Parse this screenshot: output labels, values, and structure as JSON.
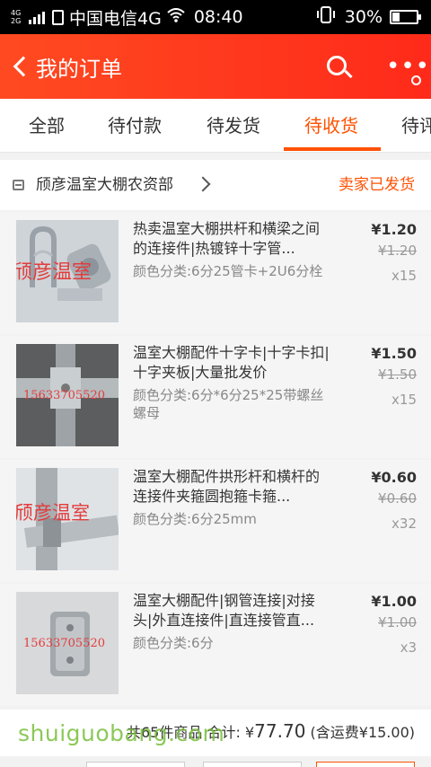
{
  "status_bar": {
    "network_top": "4G",
    "network_bottom": "2G",
    "carrier": "中国电信4G",
    "time": "08:40",
    "battery": "30%",
    "battery_level": 0.3
  },
  "header": {
    "title": "我的订单"
  },
  "tabs": [
    {
      "label": "全部"
    },
    {
      "label": "待付款"
    },
    {
      "label": "待发货"
    },
    {
      "label": "待收货",
      "active": true
    },
    {
      "label": "待评"
    }
  ],
  "shop": {
    "name": "颀彦温室大棚农资部",
    "status": "卖家已发货"
  },
  "items": [
    {
      "title": "热卖温室大棚拱杆和横梁之间的连接件|热镀锌十字管...",
      "sku": "颜色分类:6分25管卡+2U6分栓",
      "price": "¥1.20",
      "original_price": "¥1.20",
      "quantity": "x15",
      "watermark": "颀彦温室"
    },
    {
      "title": "温室大棚配件十字卡|十字卡扣|十字夹板|大量批发价",
      "sku": "颜色分类:6分*6分25*25带螺丝螺母",
      "price": "¥1.50",
      "original_price": "¥1.50",
      "quantity": "x15",
      "watermark": "15633705520"
    },
    {
      "title": "温室大棚配件拱形杆和横杆的连接件夹箍圆抱箍卡箍...",
      "sku": "颜色分类:6分25mm",
      "price": "¥0.60",
      "original_price": "¥0.60",
      "quantity": "x32",
      "watermark": "颀彦温室"
    },
    {
      "title": "温室大棚配件|钢管连接|对接头|外直连接件|直连接管直...",
      "sku": "颜色分类:6分",
      "price": "¥1.00",
      "original_price": "¥1.00",
      "quantity": "x3",
      "watermark": "15633705520"
    }
  ],
  "summary": {
    "count_text": "共65件商品",
    "total_label": "合计:",
    "currency": "¥",
    "total_amount": "77.70",
    "shipping_text": "(含运费¥15.00)"
  },
  "site_watermark": "shuiguobang.com",
  "colors": {
    "accent": "#ff5000",
    "header": "#ff3a1d",
    "watermark_red": "#e23c3c"
  }
}
